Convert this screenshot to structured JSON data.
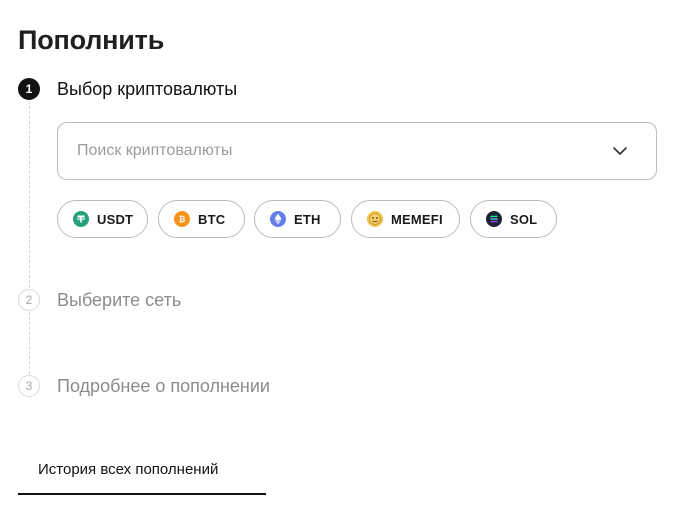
{
  "title": "Пополнить",
  "steps": [
    {
      "number": "1",
      "label": "Выбор криптовалюты",
      "state": "active"
    },
    {
      "number": "2",
      "label": "Выберите сеть",
      "state": "inactive"
    },
    {
      "number": "3",
      "label": "Подробнее о пополнении",
      "state": "inactive"
    }
  ],
  "search": {
    "placeholder": "Поиск криптовалюты",
    "value": "",
    "icon": "chevron-down-icon"
  },
  "currencies": [
    {
      "label": "USDT",
      "icon": "usdt-icon",
      "color": "#26a17b"
    },
    {
      "label": "BTC",
      "icon": "btc-icon",
      "color": "#f7931a"
    },
    {
      "label": "ETH",
      "icon": "eth-icon",
      "color": "#627eea"
    },
    {
      "label": "MEMEFI",
      "icon": "memefi-icon",
      "color": "#f2c14e"
    },
    {
      "label": "SOL",
      "icon": "sol-icon",
      "color": "#1f2235"
    }
  ],
  "history": {
    "label": "История всех пополнений"
  }
}
